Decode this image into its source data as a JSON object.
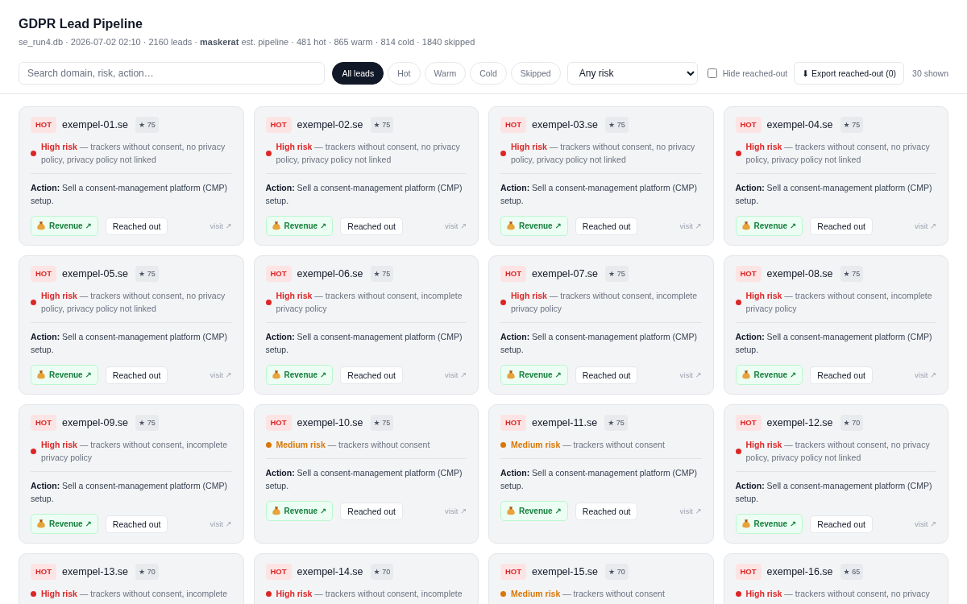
{
  "header": {
    "title": "GDPR Lead Pipeline",
    "subtitle": "se_run4.db · 2026-07-02 02:10 · 2160 leads · **maskerat** est. pipeline · 481 hot · 865 warm · 814 cold · 1840 skipped"
  },
  "toolbar": {
    "search": {
      "placeholder": "Search domain, risk, action…"
    },
    "filters": [
      {
        "label": "All leads",
        "selected": true
      },
      {
        "label": "Hot",
        "selected": false
      },
      {
        "label": "Warm",
        "selected": false
      },
      {
        "label": "Cold",
        "selected": false
      },
      {
        "label": "Skipped",
        "selected": false
      }
    ],
    "risk_select": {
      "value": "Any risk"
    },
    "hide_reached_out": {
      "label": "Hide reached-out",
      "checked": false
    },
    "export_button": "⬇ Export reached-out (0)",
    "shown_count": "30 shown"
  },
  "leads": [
    {
      "tier": "HOT",
      "domain": "exempel-01.se",
      "score": "★ 75",
      "risk": {
        "label": "High risk",
        "detail": "— trackers without consent, no privacy policy, privacy policy not linked",
        "color": "#dc2626"
      },
      "action": "**Action:** Sell a consent-management platform (CMP) setup.",
      "revenue": "Revenue ↗",
      "reached": "Reached out",
      "visit": "visit ↗"
    },
    {
      "tier": "HOT",
      "domain": "exempel-02.se",
      "score": "★ 75",
      "risk": {
        "label": "High risk",
        "detail": "— trackers without consent, no privacy policy, privacy policy not linked",
        "color": "#dc2626"
      },
      "action": "**Action:** Sell a consent-management platform (CMP) setup.",
      "revenue": "Revenue ↗",
      "reached": "Reached out",
      "visit": "visit ↗"
    },
    {
      "tier": "HOT",
      "domain": "exempel-03.se",
      "score": "★ 75",
      "risk": {
        "label": "High risk",
        "detail": "— trackers without consent, no privacy policy, privacy policy not linked",
        "color": "#dc2626"
      },
      "action": "**Action:** Sell a consent-management platform (CMP) setup.",
      "revenue": "Revenue ↗",
      "reached": "Reached out",
      "visit": "visit ↗"
    },
    {
      "tier": "HOT",
      "domain": "exempel-04.se",
      "score": "★ 75",
      "risk": {
        "label": "High risk",
        "detail": "— trackers without consent, no privacy policy, privacy policy not linked",
        "color": "#dc2626"
      },
      "action": "**Action:** Sell a consent-management platform (CMP) setup.",
      "revenue": "Revenue ↗",
      "reached": "Reached out",
      "visit": "visit ↗"
    },
    {
      "tier": "HOT",
      "domain": "exempel-05.se",
      "score": "★ 75",
      "risk": {
        "label": "High risk",
        "detail": "— trackers without consent, no privacy policy, privacy policy not linked",
        "color": "#dc2626"
      },
      "action": "**Action:** Sell a consent-management platform (CMP) setup.",
      "revenue": "Revenue ↗",
      "reached": "Reached out",
      "visit": "visit ↗"
    },
    {
      "tier": "HOT",
      "domain": "exempel-06.se",
      "score": "★ 75",
      "risk": {
        "label": "High risk",
        "detail": "— trackers without consent, incomplete privacy policy",
        "color": "#dc2626"
      },
      "action": "**Action:** Sell a consent-management platform (CMP) setup.",
      "revenue": "Revenue ↗",
      "reached": "Reached out",
      "visit": "visit ↗"
    },
    {
      "tier": "HOT",
      "domain": "exempel-07.se",
      "score": "★ 75",
      "risk": {
        "label": "High risk",
        "detail": "— trackers without consent, incomplete privacy policy",
        "color": "#dc2626"
      },
      "action": "**Action:** Sell a consent-management platform (CMP) setup.",
      "revenue": "Revenue ↗",
      "reached": "Reached out",
      "visit": "visit ↗"
    },
    {
      "tier": "HOT",
      "domain": "exempel-08.se",
      "score": "★ 75",
      "risk": {
        "label": "High risk",
        "detail": "— trackers without consent, incomplete privacy policy",
        "color": "#dc2626"
      },
      "action": "**Action:** Sell a consent-management platform (CMP) setup.",
      "revenue": "Revenue ↗",
      "reached": "Reached out",
      "visit": "visit ↗"
    },
    {
      "tier": "HOT",
      "domain": "exempel-09.se",
      "score": "★ 75",
      "risk": {
        "label": "High risk",
        "detail": "— trackers without consent, incomplete privacy policy",
        "color": "#dc2626"
      },
      "action": "**Action:** Sell a consent-management platform (CMP) setup.",
      "revenue": "Revenue ↗",
      "reached": "Reached out",
      "visit": "visit ↗"
    },
    {
      "tier": "HOT",
      "domain": "exempel-10.se",
      "score": "★ 75",
      "risk": {
        "label": "Medium risk",
        "detail": "— trackers without consent",
        "color": "#d97706"
      },
      "action": "**Action:** Sell a consent-management platform (CMP) setup.",
      "revenue": "Revenue ↗",
      "reached": "Reached out",
      "visit": "visit ↗"
    },
    {
      "tier": "HOT",
      "domain": "exempel-11.se",
      "score": "★ 75",
      "risk": {
        "label": "Medium risk",
        "detail": "— trackers without consent",
        "color": "#d97706"
      },
      "action": "**Action:** Sell a consent-management platform (CMP) setup.",
      "revenue": "Revenue ↗",
      "reached": "Reached out",
      "visit": "visit ↗"
    },
    {
      "tier": "HOT",
      "domain": "exempel-12.se",
      "score": "★ 70",
      "risk": {
        "label": "High risk",
        "detail": "— trackers without consent, no privacy policy, privacy policy not linked",
        "color": "#dc2626"
      },
      "action": "**Action:** Sell a consent-management platform (CMP) setup.",
      "revenue": "Revenue ↗",
      "reached": "Reached out",
      "visit": "visit ↗"
    },
    {
      "tier": "HOT",
      "domain": "exempel-13.se",
      "score": "★ 70",
      "risk": {
        "label": "High risk",
        "detail": "— trackers without consent, incomplete",
        "color": "#dc2626"
      }
    },
    {
      "tier": "HOT",
      "domain": "exempel-14.se",
      "score": "★ 70",
      "risk": {
        "label": "High risk",
        "detail": "— trackers without consent, incomplete",
        "color": "#dc2626"
      }
    },
    {
      "tier": "HOT",
      "domain": "exempel-15.se",
      "score": "★ 70",
      "risk": {
        "label": "Medium risk",
        "detail": "— trackers without consent",
        "color": "#d97706"
      }
    },
    {
      "tier": "HOT",
      "domain": "exempel-16.se",
      "score": "★ 65",
      "risk": {
        "label": "High risk",
        "detail": "— trackers without consent, no privacy",
        "color": "#dc2626"
      }
    }
  ]
}
